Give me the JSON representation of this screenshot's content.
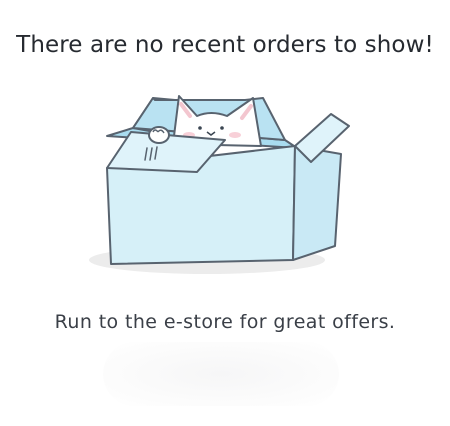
{
  "empty_state": {
    "title": "There are no recent orders to show!",
    "subtitle": "Run to the e-store for great offers.",
    "illustration_icon": "cat-in-box-icon",
    "cta_label": ""
  },
  "colors": {
    "box_fill": "#d6f0f8",
    "box_inner": "#a9dcef",
    "box_outline": "#58636f",
    "shadow": "#ececec",
    "text": "#262a30"
  }
}
